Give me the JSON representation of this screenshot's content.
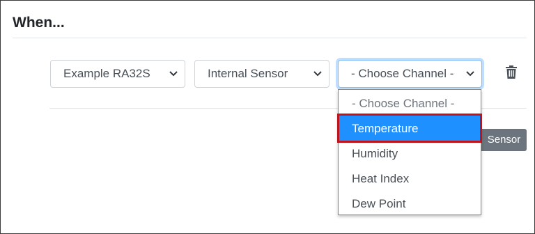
{
  "section": {
    "title": "When..."
  },
  "condition_row": {
    "device_select": {
      "value": "Example RA32S"
    },
    "source_select": {
      "value": "Internal Sensor"
    },
    "channel_select": {
      "value": "- Choose Channel -",
      "options": [
        "- Choose Channel -",
        "Temperature",
        "Humidity",
        "Heat Index",
        "Dew Point"
      ],
      "highlighted_option": "Temperature"
    },
    "badge": "Sensor",
    "delete_icon": "trash-icon"
  },
  "colors": {
    "highlight": "#1e90ff",
    "highlight_outline": "#c0141c",
    "badge": "#6c757d"
  }
}
